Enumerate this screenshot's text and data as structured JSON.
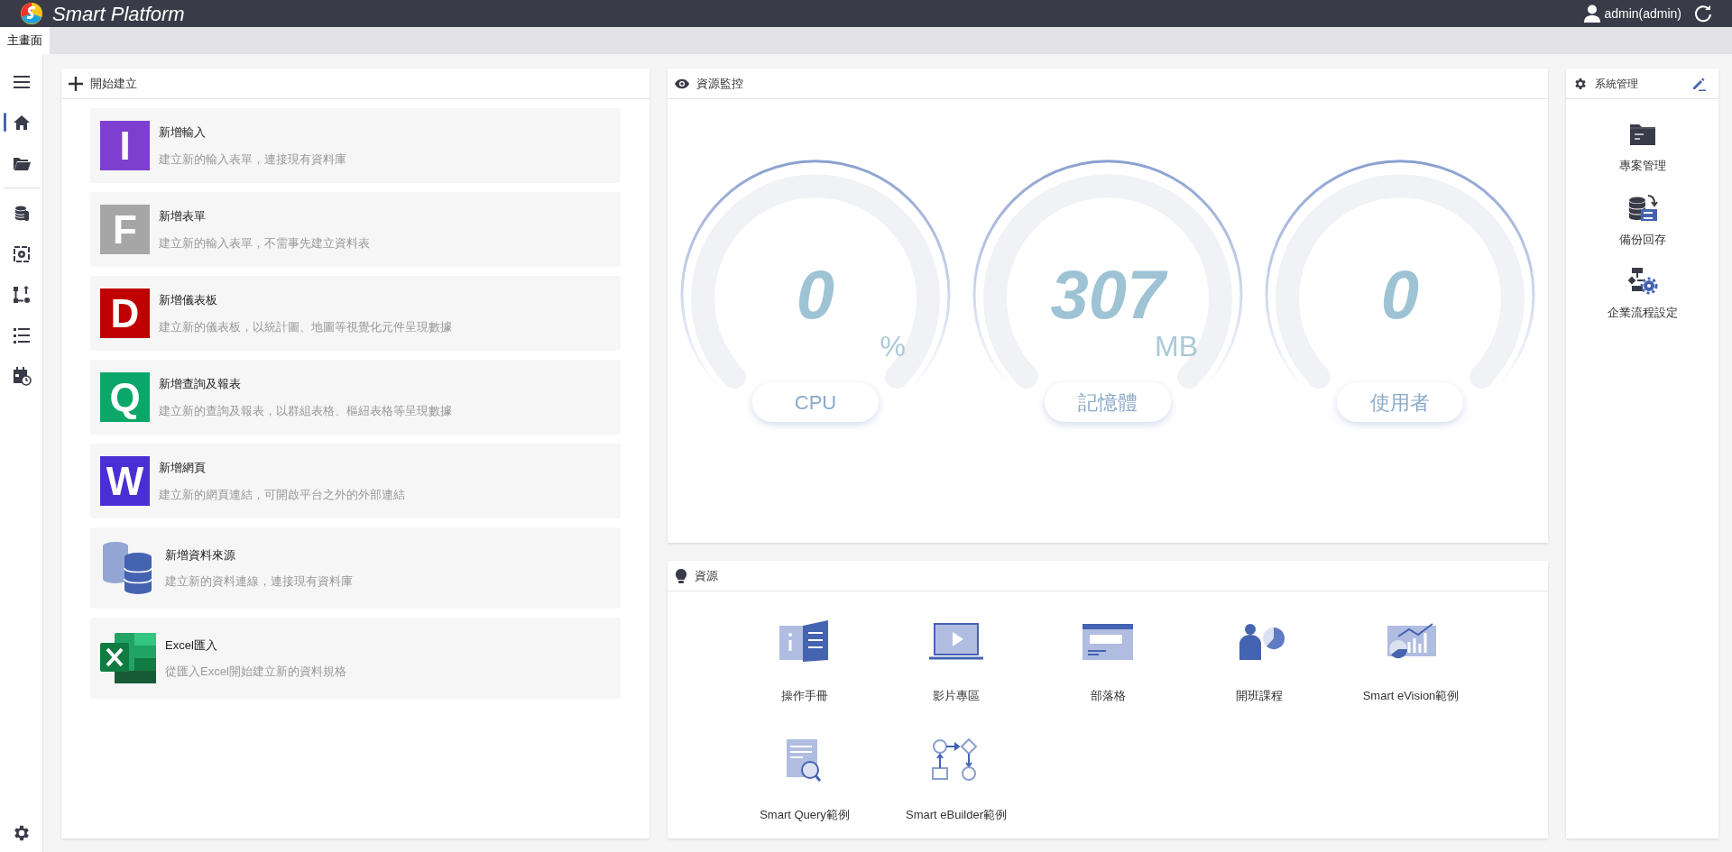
{
  "header": {
    "app_title": "Smart Platform",
    "user": "admin(admin)"
  },
  "tabs": [
    {
      "label": "主畫面",
      "selected": true
    }
  ],
  "sidebar": {
    "items": [
      {
        "selected": false
      },
      {
        "selected": true
      },
      {
        "selected": false
      },
      {
        "selected": false
      },
      {
        "selected": false
      },
      {
        "selected": false
      },
      {
        "selected": false
      },
      {
        "selected": false
      }
    ]
  },
  "create": {
    "title": "開始建立",
    "items": [
      {
        "kind": "letter",
        "letter": "I",
        "color": "#7e3fd0",
        "title": "新增輸入",
        "description": "建立新的輸入表單，連接現有資料庫"
      },
      {
        "kind": "letter",
        "letter": "F",
        "color": "#a6a6a6",
        "title": "新增表單",
        "description": "建立新的輸入表單，不需事先建立資料表"
      },
      {
        "kind": "letter",
        "letter": "D",
        "color": "#c00000",
        "title": "新增儀表板",
        "description": "建立新的儀表板，以統計圖、地圖等視覺化元件呈現數據"
      },
      {
        "kind": "letter",
        "letter": "Q",
        "color": "#0aa768",
        "title": "新增查詢及報表",
        "description": "建立新的查詢及報表，以群組表格、樞紐表格等呈現數據"
      },
      {
        "kind": "letter",
        "letter": "W",
        "color": "#4a2fd6",
        "title": "新增網頁",
        "description": "建立新的網頁連結，可開啟平台之外的外部連結"
      },
      {
        "kind": "database",
        "title": "新增資料來源",
        "description": "建立新的資料連線，連接現有資料庫"
      },
      {
        "kind": "excel",
        "title": "Excel匯入",
        "description": "從匯入Excel開始建立新的資料規格"
      }
    ]
  },
  "monitor": {
    "title": "資源監控",
    "gauges": [
      {
        "value": "0",
        "unit": "%",
        "label": "CPU"
      },
      {
        "value": "307",
        "unit": "MB",
        "label": "記憶體"
      },
      {
        "value": "0",
        "label": "使用者"
      }
    ]
  },
  "resources": {
    "title": "資源",
    "items": [
      {
        "label": "操作手冊"
      },
      {
        "label": "影片專區"
      },
      {
        "label": "部落格"
      },
      {
        "label": "開班課程"
      },
      {
        "label": "Smart eVision範例"
      },
      {
        "label": "Smart Query範例"
      },
      {
        "label": "Smart eBuilder範例"
      }
    ]
  },
  "system": {
    "title": "系統管理",
    "items": [
      {
        "label": "專案管理"
      },
      {
        "label": "備份回存"
      },
      {
        "label": "企業流程設定"
      }
    ]
  }
}
